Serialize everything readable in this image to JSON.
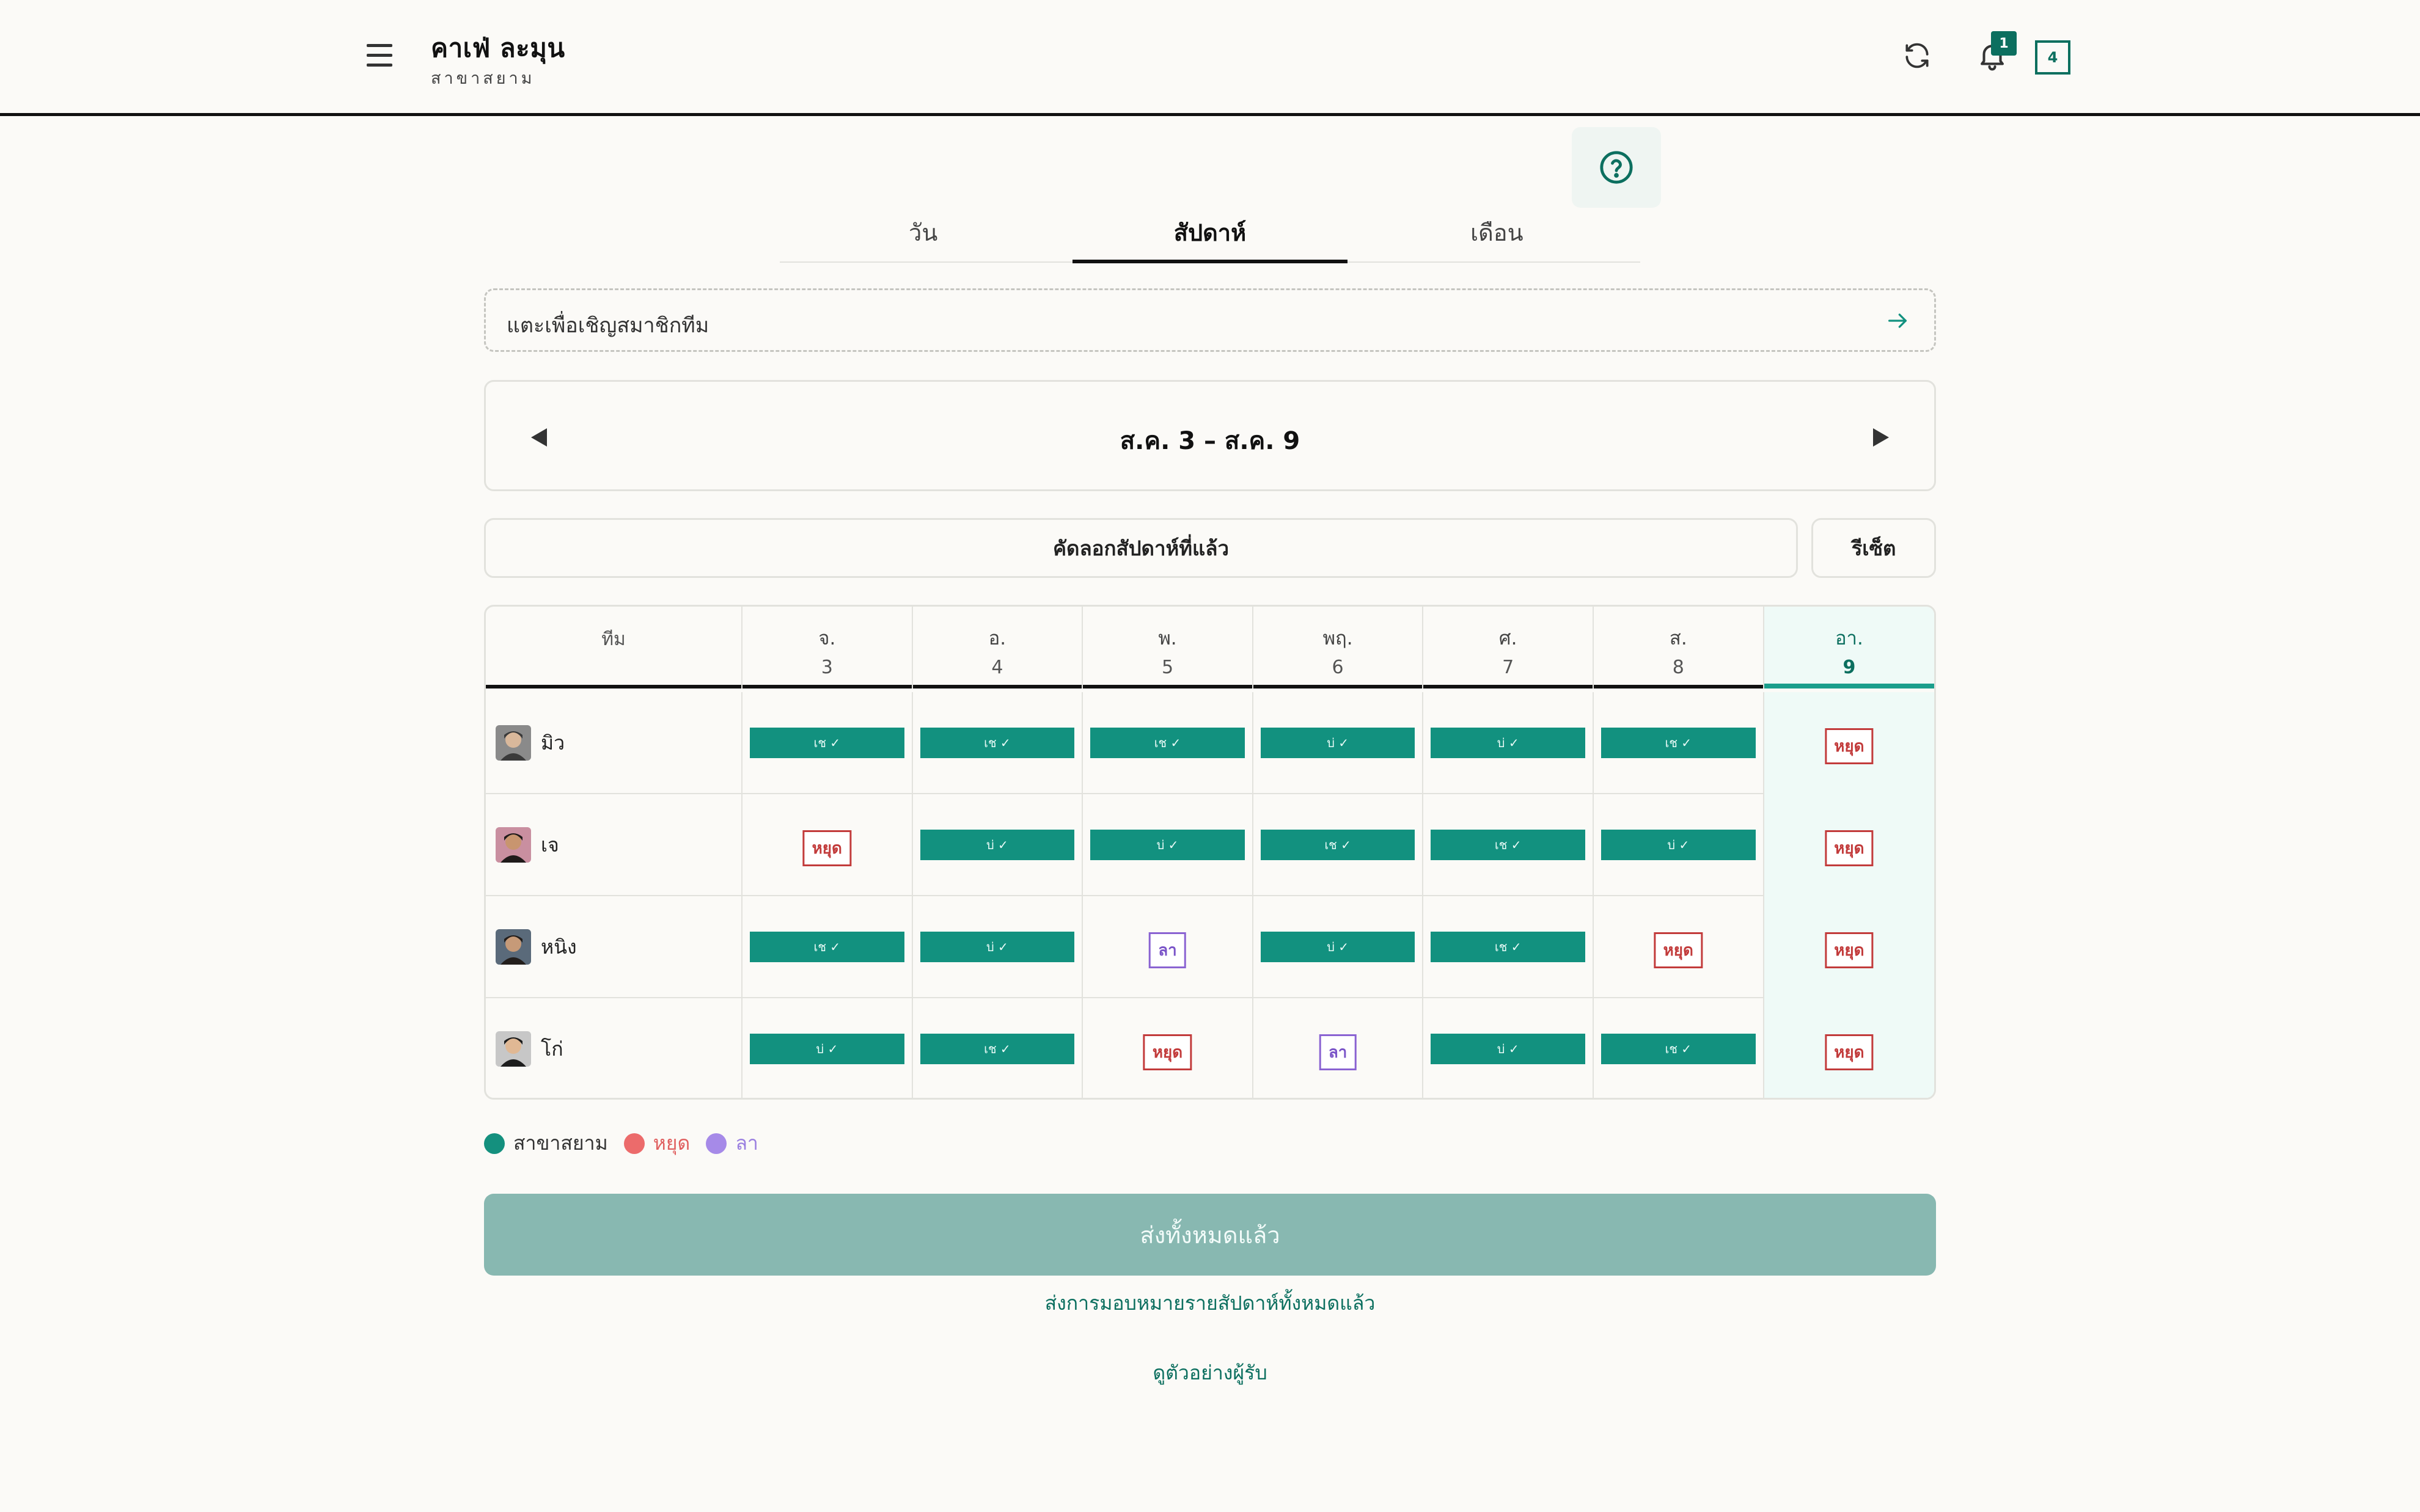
{
  "header": {
    "title": "คาเฟ่ ละมุน",
    "subtitle": "สาขาสยาม",
    "notification_count": "1",
    "pending_count": "4"
  },
  "tabs": [
    {
      "label": "วัน",
      "active": false
    },
    {
      "label": "สัปดาห์",
      "active": true
    },
    {
      "label": "เดือน",
      "active": false
    }
  ],
  "invite": {
    "label": "แตะเพื่อเชิญสมาชิกทีม"
  },
  "week": {
    "label": "ส.ค. 3 – ส.ค. 9"
  },
  "actions": {
    "copy_label": "คัดลอกสัปดาห์ที่แล้ว",
    "reset_label": "รีเซ็ต"
  },
  "grid": {
    "team_header": "ทีม",
    "days": [
      {
        "name": "จ.",
        "num": "3",
        "today": false
      },
      {
        "name": "อ.",
        "num": "4",
        "today": false
      },
      {
        "name": "พ.",
        "num": "5",
        "today": false
      },
      {
        "name": "พฤ.",
        "num": "6",
        "today": false
      },
      {
        "name": "ศ.",
        "num": "7",
        "today": false
      },
      {
        "name": "ส.",
        "num": "8",
        "today": false
      },
      {
        "name": "อา.",
        "num": "9",
        "today": true
      }
    ],
    "members": [
      {
        "name": "มิว",
        "avatar": "avatar-man-1",
        "cells": [
          {
            "type": "shift",
            "label": "เช ✓"
          },
          {
            "type": "shift",
            "label": "เช ✓"
          },
          {
            "type": "shift",
            "label": "เช ✓"
          },
          {
            "type": "shift",
            "label": "บ่ ✓"
          },
          {
            "type": "shift",
            "label": "บ่ ✓"
          },
          {
            "type": "shift",
            "label": "เช ✓"
          },
          {
            "type": "off",
            "label": "หยุด"
          }
        ]
      },
      {
        "name": "เจ",
        "avatar": "avatar-woman-1",
        "cells": [
          {
            "type": "off",
            "label": "หยุด"
          },
          {
            "type": "shift",
            "label": "บ่ ✓"
          },
          {
            "type": "shift",
            "label": "บ่ ✓"
          },
          {
            "type": "shift",
            "label": "เช ✓"
          },
          {
            "type": "shift",
            "label": "เช ✓"
          },
          {
            "type": "shift",
            "label": "บ่ ✓"
          },
          {
            "type": "off",
            "label": "หยุด"
          }
        ]
      },
      {
        "name": "หนิง",
        "avatar": "avatar-woman-2",
        "cells": [
          {
            "type": "shift",
            "label": "เช ✓"
          },
          {
            "type": "shift",
            "label": "บ่ ✓"
          },
          {
            "type": "leave",
            "label": "ลา"
          },
          {
            "type": "shift",
            "label": "บ่ ✓"
          },
          {
            "type": "shift",
            "label": "เช ✓"
          },
          {
            "type": "off",
            "label": "หยุด"
          },
          {
            "type": "off",
            "label": "หยุด"
          }
        ]
      },
      {
        "name": "โก่",
        "avatar": "avatar-man-2",
        "cells": [
          {
            "type": "shift",
            "label": "บ่ ✓"
          },
          {
            "type": "shift",
            "label": "เช ✓"
          },
          {
            "type": "off",
            "label": "หยุด"
          },
          {
            "type": "leave",
            "label": "ลา"
          },
          {
            "type": "shift",
            "label": "บ่ ✓"
          },
          {
            "type": "shift",
            "label": "เช ✓"
          },
          {
            "type": "off",
            "label": "หยุด"
          }
        ]
      }
    ]
  },
  "legend": [
    {
      "label": "สาขาสยาม",
      "color": "#14907e",
      "text_color": "#333333"
    },
    {
      "label": "หยุด",
      "color": "#ec6b6b",
      "text_color": "#e06060"
    },
    {
      "label": "ลา",
      "color": "#a68ae8",
      "text_color": "#9a7fe0"
    }
  ],
  "footer": {
    "submit_label": "ส่งทั้งหมดแล้ว",
    "sent_note": "ส่งการมอบหมายรายสัปดาห์ทั้งหมดแล้ว",
    "preview_label": "ดูตัวอย่างผู้รับ"
  },
  "colors": {
    "accent": "#0c6f5f",
    "shift": "#12917f",
    "off": "#c23b3b",
    "leave": "#8a63d2",
    "today_bg": "#effaf7"
  }
}
